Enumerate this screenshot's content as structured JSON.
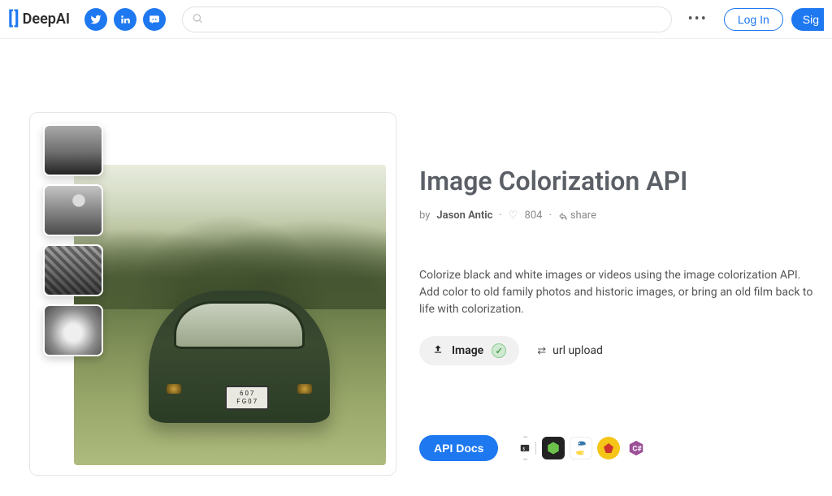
{
  "header": {
    "brand": "DeepAI",
    "search_placeholder": "",
    "login_label": "Log In",
    "signup_label": "Sig"
  },
  "page": {
    "title": "Image Colorization API",
    "by_prefix": "by",
    "author": "Jason Antic",
    "likes": "804",
    "share_label": "share",
    "description": "Colorize black and white images or videos using the image colorization API. Add color to old family photos and historic images, or bring an old film back to life with colorization.",
    "image_upload_label": "Image",
    "url_upload_label": "url upload",
    "api_docs_label": "API Docs",
    "plate_line1": "6 0 7",
    "plate_line2": "F G 0 7"
  }
}
